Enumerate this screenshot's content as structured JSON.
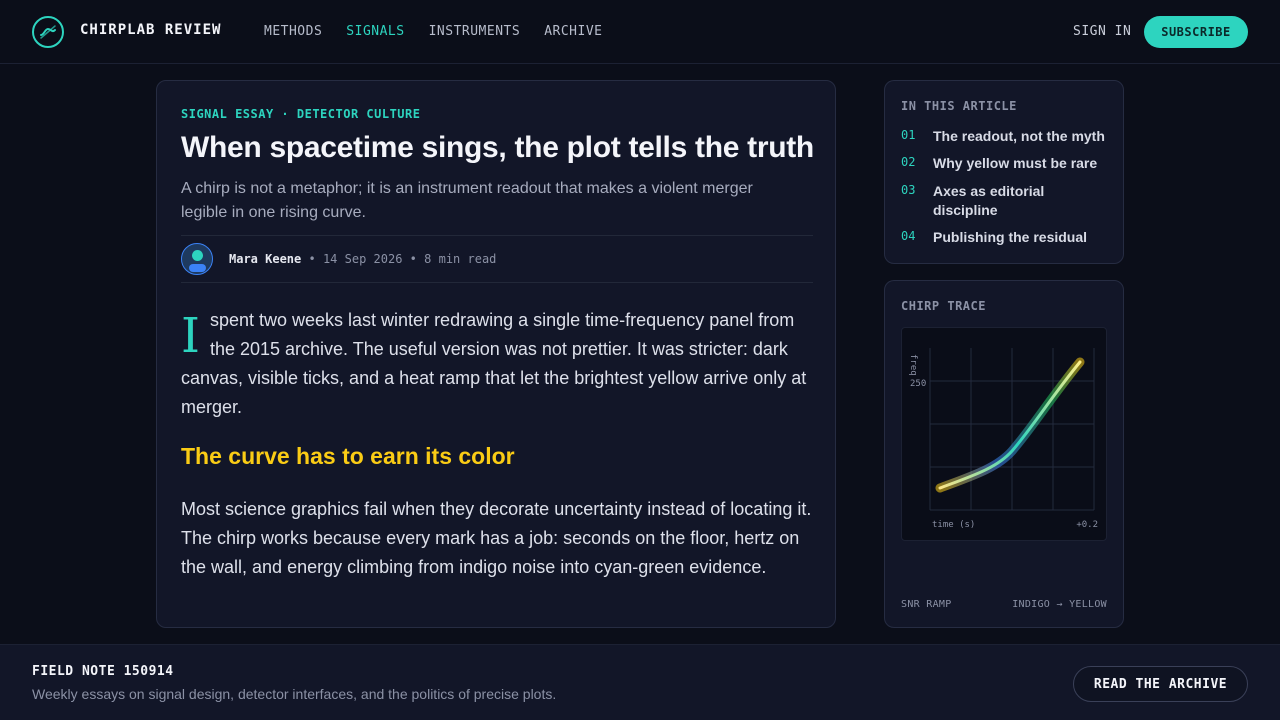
{
  "brand": {
    "name": "CHIRPLAB REVIEW",
    "logo_icon": "chirp-wave-icon"
  },
  "nav": {
    "items": [
      {
        "label": "METHODS",
        "active": false
      },
      {
        "label": "SIGNALS",
        "active": true
      },
      {
        "label": "INSTRUMENTS",
        "active": false
      },
      {
        "label": "ARCHIVE",
        "active": false
      }
    ],
    "sign_in": "SIGN IN",
    "subscribe": "SUBSCRIBE"
  },
  "article": {
    "kicker": "SIGNAL ESSAY · DETECTOR CULTURE",
    "title": "When spacetime sings, the plot tells the truth",
    "dek": "A chirp is not a metaphor; it is an instrument readout that makes a violent merger legible in one rising curve.",
    "byline": {
      "author": "Mara Keene",
      "date": "14 Sep 2026",
      "read_time": "8 min read",
      "separator": "•"
    },
    "dropcap": "I",
    "para1": "spent two weeks last winter redrawing a single time-frequency panel from the 2015 archive. The useful version was not prettier. It was stricter: dark canvas, visible ticks, and a heat ramp that let the brightest yellow arrive only at merger.",
    "subhead": "The curve has to earn its color",
    "para2": "Most science graphics fail when they decorate uncertainty instead of locating it. The chirp works because every mark has a job: seconds on the floor, hertz on the wall, and energy climbing from indigo noise into cyan-green evidence."
  },
  "toc": {
    "label": "IN THIS ARTICLE",
    "items": [
      {
        "num": "01",
        "label": "The readout, not the myth"
      },
      {
        "num": "02",
        "label": "Why yellow must be rare"
      },
      {
        "num": "03",
        "label": "Axes as editorial discipline"
      },
      {
        "num": "04",
        "label": "Publishing the residual"
      }
    ]
  },
  "trace": {
    "label": "CHIRP TRACE",
    "ylabel": "freq",
    "ytick": "250",
    "xlabel": "time (s)",
    "xtick": "+0.2",
    "foot_left": "SNR RAMP",
    "foot_right": "INDIGO → YELLOW",
    "colors": {
      "start": "#3b4fb0",
      "mid": "#22c55e",
      "end": "#facc15",
      "accent": "#2dd4bf"
    }
  },
  "footer": {
    "title": "FIELD NOTE 150914",
    "desc": "Weekly essays on signal design, detector interfaces, and the politics of precise plots.",
    "button": "READ THE ARCHIVE"
  }
}
